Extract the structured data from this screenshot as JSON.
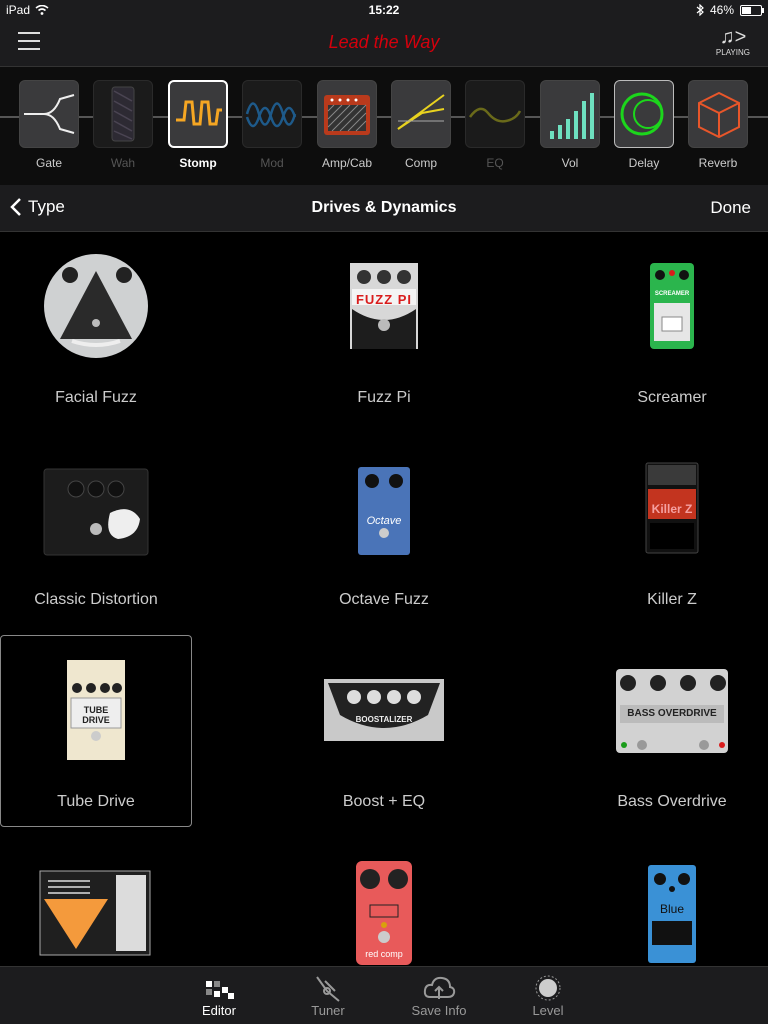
{
  "status": {
    "device": "iPad",
    "time": "15:22",
    "battery": "46%",
    "battery_level": 0.46
  },
  "nav": {
    "title": "Lead the Way",
    "playing_label": "PLAYING",
    "title_color": "#d4000c"
  },
  "blocks": [
    {
      "label": "Gate",
      "icon": "gate-icon",
      "state": "normal"
    },
    {
      "label": "Wah",
      "icon": "wah-icon",
      "state": "dim"
    },
    {
      "label": "Stomp",
      "icon": "stomp-icon",
      "state": "selected"
    },
    {
      "label": "Mod",
      "icon": "mod-icon",
      "state": "dim"
    },
    {
      "label": "Amp/Cab",
      "icon": "amp-icon",
      "state": "normal"
    },
    {
      "label": "Comp",
      "icon": "comp-icon",
      "state": "normal"
    },
    {
      "label": "EQ",
      "icon": "eq-icon",
      "state": "dim"
    },
    {
      "label": "Vol",
      "icon": "vol-icon",
      "state": "normal"
    },
    {
      "label": "Delay",
      "icon": "delay-icon",
      "state": "outlined"
    },
    {
      "label": "Reverb",
      "icon": "reverb-icon",
      "state": "normal"
    }
  ],
  "typebar": {
    "back_label": "Type",
    "title": "Drives & Dynamics",
    "done_label": "Done"
  },
  "pedals": [
    {
      "name": "Facial Fuzz"
    },
    {
      "name": "Fuzz Pi",
      "text": "FUZZ PI"
    },
    {
      "name": "Screamer",
      "text": "SCREAMER"
    },
    {
      "name": "Classic Distortion"
    },
    {
      "name": "Octave Fuzz",
      "text": "Octave"
    },
    {
      "name": "Killer Z",
      "text": "Killer Z"
    },
    {
      "name": "Tube Drive",
      "text": "TUBE DRIVE",
      "selected": true
    },
    {
      "name": "Boost + EQ",
      "text": "BOOSTALIZER"
    },
    {
      "name": "Bass Overdrive",
      "text": "BASS OVERDRIVE"
    },
    {
      "name": ""
    },
    {
      "name": "",
      "text": "red comp"
    },
    {
      "name": "",
      "text": "Blue"
    }
  ],
  "tabs": [
    {
      "label": "Editor",
      "icon": "editor-icon",
      "active": true
    },
    {
      "label": "Tuner",
      "icon": "tuner-icon",
      "active": false
    },
    {
      "label": "Save Info",
      "icon": "cloud-upload-icon",
      "active": false
    },
    {
      "label": "Level",
      "icon": "level-knob-icon",
      "active": false
    }
  ]
}
